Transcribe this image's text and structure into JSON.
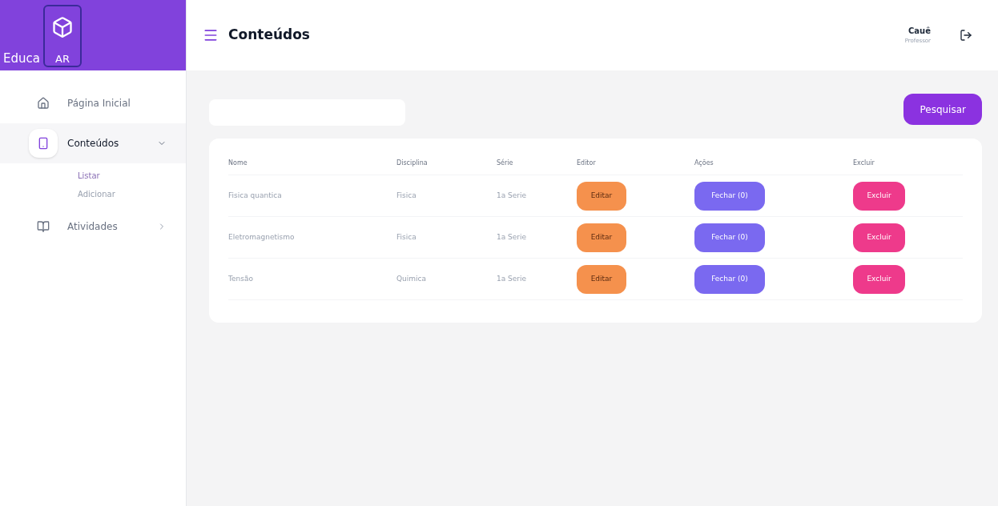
{
  "logo": {
    "left": "Educa",
    "right": "AR"
  },
  "header": {
    "title": "Conteúdos",
    "user": {
      "name": "Cauê",
      "role": "Professor"
    }
  },
  "sidebar": {
    "items": [
      {
        "label": "Página Inicial",
        "selected": false
      },
      {
        "label": "Conteúdos",
        "selected": true,
        "expanded": true,
        "children": [
          {
            "label": "Listar",
            "selected": true
          },
          {
            "label": "Adicionar",
            "selected": false
          }
        ]
      },
      {
        "label": "Atividades",
        "selected": false,
        "expanded": false
      }
    ]
  },
  "search": {
    "button": "Pesquisar"
  },
  "table": {
    "columns": [
      "Nome",
      "Disciplina",
      "Série",
      "Editor",
      "Ações",
      "Excluir"
    ],
    "rows": [
      {
        "cells": [
          "Fisica quantica",
          "Fisica",
          "1a Serie"
        ],
        "edit": "Editar",
        "action": "Fechar (0)",
        "delete": "Excluir"
      },
      {
        "cells": [
          "Eletromagnetismo",
          "Fisica",
          "1a Serie"
        ],
        "edit": "Editar",
        "action": "Fechar (0)",
        "delete": "Excluir"
      },
      {
        "cells": [
          "Tensão",
          "Quimica",
          "1a Serie"
        ],
        "edit": "Editar",
        "action": "Fechar (0)",
        "delete": "Excluir"
      }
    ]
  }
}
